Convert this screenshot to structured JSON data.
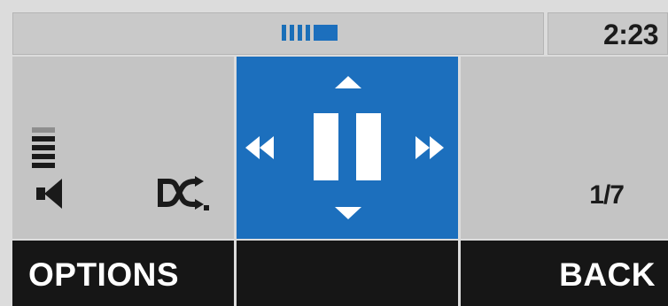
{
  "status": {
    "time": "2:23",
    "progress_fraction": 0.6,
    "accent_color": "#1c6fbd"
  },
  "left_panel": {
    "volume_level": 4,
    "volume_max": 5,
    "volume_icon": "speaker-icon",
    "shuffle_icon": "shuffle-icon"
  },
  "center_panel": {
    "play_state": "paused",
    "icons": [
      "arrow-up-icon",
      "arrow-down-icon",
      "rewind-icon",
      "pause-icon",
      "fast-forward-icon"
    ]
  },
  "right_panel": {
    "track_count": "1/7"
  },
  "softkeys": {
    "left_label": "OPTIONS",
    "right_label": "BACK"
  }
}
